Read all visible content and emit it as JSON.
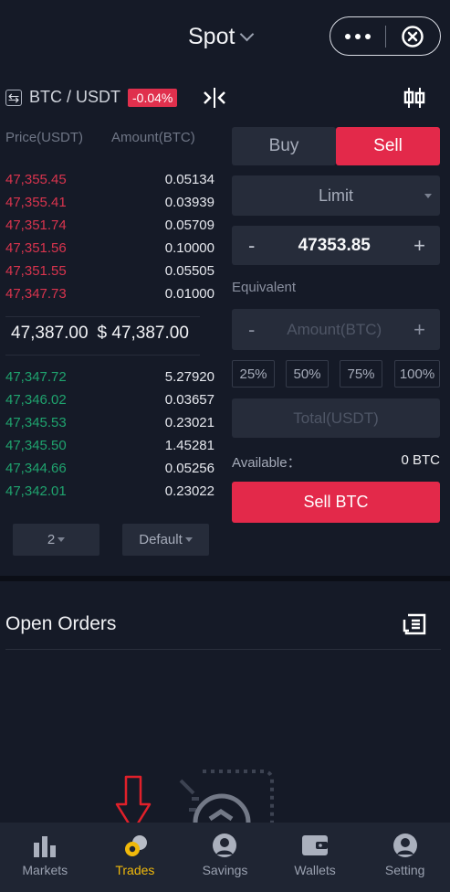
{
  "header": {
    "title": "Spot"
  },
  "pair": {
    "name": "BTC / USDT",
    "change": "-0.04%"
  },
  "orderbook": {
    "price_header": "Price(USDT)",
    "amount_header": "Amount(BTC)",
    "asks": [
      {
        "price": "47,355.45",
        "amount": "0.05134"
      },
      {
        "price": "47,355.41",
        "amount": "0.03939"
      },
      {
        "price": "47,351.74",
        "amount": "0.05709"
      },
      {
        "price": "47,351.56",
        "amount": "0.10000"
      },
      {
        "price": "47,351.55",
        "amount": "0.05505"
      },
      {
        "price": "47,347.73",
        "amount": "0.01000"
      }
    ],
    "last_price": "47,387.00",
    "last_price_usd": "$ 47,387.00",
    "bids": [
      {
        "price": "47,347.72",
        "amount": "5.27920"
      },
      {
        "price": "47,346.02",
        "amount": "0.03657"
      },
      {
        "price": "47,345.53",
        "amount": "0.23021"
      },
      {
        "price": "47,345.50",
        "amount": "1.45281"
      },
      {
        "price": "47,344.66",
        "amount": "0.05256"
      },
      {
        "price": "47,342.01",
        "amount": "0.23022"
      }
    ],
    "precision": "2",
    "view_mode": "Default"
  },
  "trade": {
    "buy_label": "Buy",
    "sell_label": "Sell",
    "order_type": "Limit",
    "minus": "-",
    "plus": "+",
    "price_value": "47353.85",
    "equivalent_label": "Equivalent",
    "amount_placeholder": "Amount(BTC)",
    "percentages": [
      "25%",
      "50%",
      "75%",
      "100%"
    ],
    "total_placeholder": "Total(USDT)",
    "available_label": "Available：",
    "available_value": "0 BTC",
    "submit_label": "Sell BTC"
  },
  "open_orders": {
    "title": "Open Orders"
  },
  "nav": {
    "items": [
      {
        "label": "Markets",
        "icon": "bar-chart-icon"
      },
      {
        "label": "Trades",
        "icon": "coins-icon"
      },
      {
        "label": "Savings",
        "icon": "person-circle-icon"
      },
      {
        "label": "Wallets",
        "icon": "wallet-icon"
      },
      {
        "label": "Setting",
        "icon": "person-circle-icon"
      }
    ],
    "active_color": "#f0b90b"
  },
  "colors": {
    "accent_red": "#e3294a",
    "ask": "#d9344e",
    "bid": "#1fa36e",
    "background": "#151a27"
  }
}
